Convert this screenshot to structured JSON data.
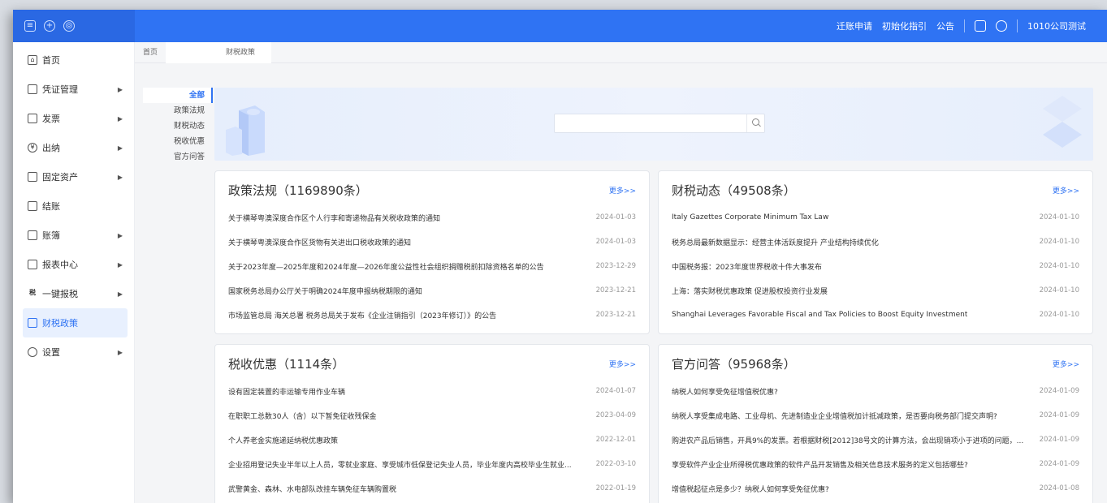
{
  "topbar": {
    "links": [
      "迁账申请",
      "初始化指引",
      "公告"
    ],
    "company": "1010公司测试"
  },
  "tabs": [
    {
      "label": "首页"
    },
    {
      "label": "财税政策",
      "close": "×"
    }
  ],
  "sidebar": {
    "items": [
      {
        "label": "首页",
        "icon": "home-icon"
      },
      {
        "label": "凭证管理",
        "icon": "voucher-icon"
      },
      {
        "label": "发票",
        "icon": "invoice-icon"
      },
      {
        "label": "出纳",
        "icon": "cashier-icon"
      },
      {
        "label": "固定资产",
        "icon": "asset-icon"
      },
      {
        "label": "结账",
        "icon": "closing-icon"
      },
      {
        "label": "账簿",
        "icon": "ledger-icon"
      },
      {
        "label": "报表中心",
        "icon": "report-icon"
      },
      {
        "label": "一键报税",
        "icon": "tax-icon"
      },
      {
        "label": "财税政策",
        "icon": "policy-icon"
      },
      {
        "label": "设置",
        "icon": "settings-icon"
      }
    ]
  },
  "categories": [
    "全部",
    "政策法规",
    "财税动态",
    "税收优惠",
    "官方问答"
  ],
  "search": {
    "placeholder": ""
  },
  "cards": {
    "policy": {
      "title": "政策法规（1169890条）",
      "more": "更多>>",
      "rows": [
        {
          "title": "关于横琴粤澳深度合作区个人行李和寄递物品有关税收政策的通知",
          "date": "2024-01-03"
        },
        {
          "title": "关于横琴粤澳深度合作区货物有关进出口税收政策的通知",
          "date": "2024-01-03"
        },
        {
          "title": "关于2023年度—2025年度和2024年度—2026年度公益性社会组织捐赠税前扣除资格名单的公告",
          "date": "2023-12-29"
        },
        {
          "title": "国家税务总局办公厅关于明确2024年度申报纳税期限的通知",
          "date": "2023-12-21"
        },
        {
          "title": "市场监管总局 海关总署 税务总局关于发布《企业注销指引（2023年修订）》的公告",
          "date": "2023-12-21"
        }
      ]
    },
    "news": {
      "title": "财税动态（49508条）",
      "more": "更多>>",
      "rows": [
        {
          "title": "Italy Gazettes Corporate Minimum Tax Law",
          "date": "2024-01-10"
        },
        {
          "title": "税务总局最新数据显示：经营主体活跃度提升 产业结构持续优化",
          "date": "2024-01-10"
        },
        {
          "title": "中国税务报：2023年度世界税收十件大事发布",
          "date": "2024-01-10"
        },
        {
          "title": "上海：落实财税优惠政策 促进股权投资行业发展",
          "date": "2024-01-10"
        },
        {
          "title": "Shanghai Leverages Favorable Fiscal and Tax Policies to Boost Equity Investment",
          "date": "2024-01-10"
        }
      ]
    },
    "preferential": {
      "title": "税收优惠（1114条）",
      "more": "更多>>",
      "rows": [
        {
          "title": "设有固定装置的非运输专用作业车辆",
          "date": "2024-01-07"
        },
        {
          "title": "在职职工总数30人（含）以下暂免征收残保金",
          "date": "2023-04-09"
        },
        {
          "title": "个人养老金实施递延纳税优惠政策",
          "date": "2022-12-01"
        },
        {
          "title": "企业招用登记失业半年以上人员，零就业家庭、享受城市低保登记失业人员，毕业年度内高校毕业生就业...",
          "date": "2022-03-10"
        },
        {
          "title": "武警黄金、森林、水电部队改挂车辆免征车辆购置税",
          "date": "2022-01-19"
        }
      ]
    },
    "qa": {
      "title": "官方问答（95968条）",
      "more": "更多>>",
      "rows": [
        {
          "title": "纳税人如何享受免征增值税优惠?",
          "date": "2024-01-09"
        },
        {
          "title": "纳税人享受集成电路、工业母机、先进制造业企业增值税加计抵减政策，是否要向税务部门提交声明?",
          "date": "2024-01-09"
        },
        {
          "title": "购进农产品后销售，开具9%的发票。若根据财税[2012]38号文的计算方法，会出现销项小于进项的问题，...",
          "date": "2024-01-09"
        },
        {
          "title": "享受软件产业企业所得税优惠政策的软件产品开发销售及相关信息技术服务的定义包括哪些?",
          "date": "2024-01-09"
        },
        {
          "title": "增值税起征点是多少？纳税人如何享受免征优惠?",
          "date": "2024-01-08"
        }
      ]
    }
  }
}
